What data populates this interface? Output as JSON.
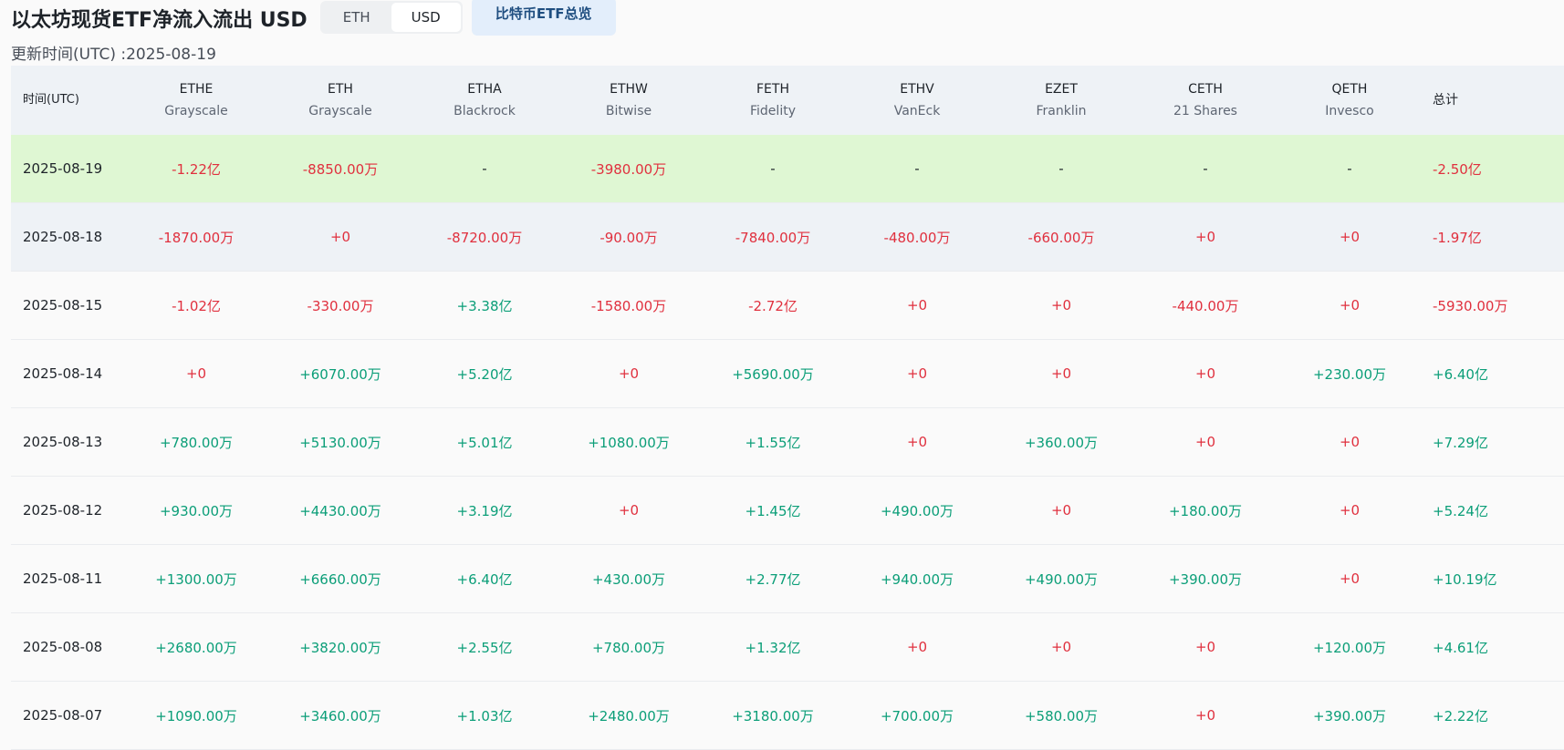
{
  "header": {
    "title": "以太坊现货ETF净流入流出 USD",
    "toggle": [
      "ETH",
      "USD"
    ],
    "active_toggle": "USD",
    "btc_button": "比特币ETF总览",
    "updated": "更新时间(UTC) :2025-08-19"
  },
  "table": {
    "date_header": "时间(UTC)",
    "total_header": "总计",
    "funds": [
      {
        "ticker": "ETHE",
        "issuer": "Grayscale"
      },
      {
        "ticker": "ETH",
        "issuer": "Grayscale"
      },
      {
        "ticker": "ETHA",
        "issuer": "Blackrock"
      },
      {
        "ticker": "ETHW",
        "issuer": "Bitwise"
      },
      {
        "ticker": "FETH",
        "issuer": "Fidelity"
      },
      {
        "ticker": "ETHV",
        "issuer": "VanEck"
      },
      {
        "ticker": "EZET",
        "issuer": "Franklin"
      },
      {
        "ticker": "CETH",
        "issuer": "21 Shares"
      },
      {
        "ticker": "QETH",
        "issuer": "Invesco"
      }
    ],
    "rows": [
      {
        "date": "2025-08-19",
        "values": [
          "-1.22亿",
          "-8850.00万",
          "-",
          "-3980.00万",
          "-",
          "-",
          "-",
          "-",
          "-"
        ],
        "total": "-2.50亿"
      },
      {
        "date": "2025-08-18",
        "values": [
          "-1870.00万",
          "+0",
          "-8720.00万",
          "-90.00万",
          "-7840.00万",
          "-480.00万",
          "-660.00万",
          "+0",
          "+0"
        ],
        "total": "-1.97亿"
      },
      {
        "date": "2025-08-15",
        "values": [
          "-1.02亿",
          "-330.00万",
          "+3.38亿",
          "-1580.00万",
          "-2.72亿",
          "+0",
          "+0",
          "-440.00万",
          "+0"
        ],
        "total": "-5930.00万"
      },
      {
        "date": "2025-08-14",
        "values": [
          "+0",
          "+6070.00万",
          "+5.20亿",
          "+0",
          "+5690.00万",
          "+0",
          "+0",
          "+0",
          "+230.00万"
        ],
        "total": "+6.40亿"
      },
      {
        "date": "2025-08-13",
        "values": [
          "+780.00万",
          "+5130.00万",
          "+5.01亿",
          "+1080.00万",
          "+1.55亿",
          "+0",
          "+360.00万",
          "+0",
          "+0"
        ],
        "total": "+7.29亿"
      },
      {
        "date": "2025-08-12",
        "values": [
          "+930.00万",
          "+4430.00万",
          "+3.19亿",
          "+0",
          "+1.45亿",
          "+490.00万",
          "+0",
          "+180.00万",
          "+0"
        ],
        "total": "+5.24亿"
      },
      {
        "date": "2025-08-11",
        "values": [
          "+1300.00万",
          "+6660.00万",
          "+6.40亿",
          "+430.00万",
          "+2.77亿",
          "+940.00万",
          "+490.00万",
          "+390.00万",
          "+0"
        ],
        "total": "+10.19亿"
      },
      {
        "date": "2025-08-08",
        "values": [
          "+2680.00万",
          "+3820.00万",
          "+2.55亿",
          "+780.00万",
          "+1.32亿",
          "+0",
          "+0",
          "+0",
          "+120.00万"
        ],
        "total": "+4.61亿"
      },
      {
        "date": "2025-08-07",
        "values": [
          "+1090.00万",
          "+3460.00万",
          "+1.03亿",
          "+2480.00万",
          "+3180.00万",
          "+700.00万",
          "+580.00万",
          "+0",
          "+390.00万"
        ],
        "total": "+2.22亿"
      }
    ]
  },
  "colors": {
    "positive": "#0b9e78",
    "negative": "#e0303e",
    "highlight_today": "#dff7d3",
    "highlight_hover": "#eef2f6"
  }
}
